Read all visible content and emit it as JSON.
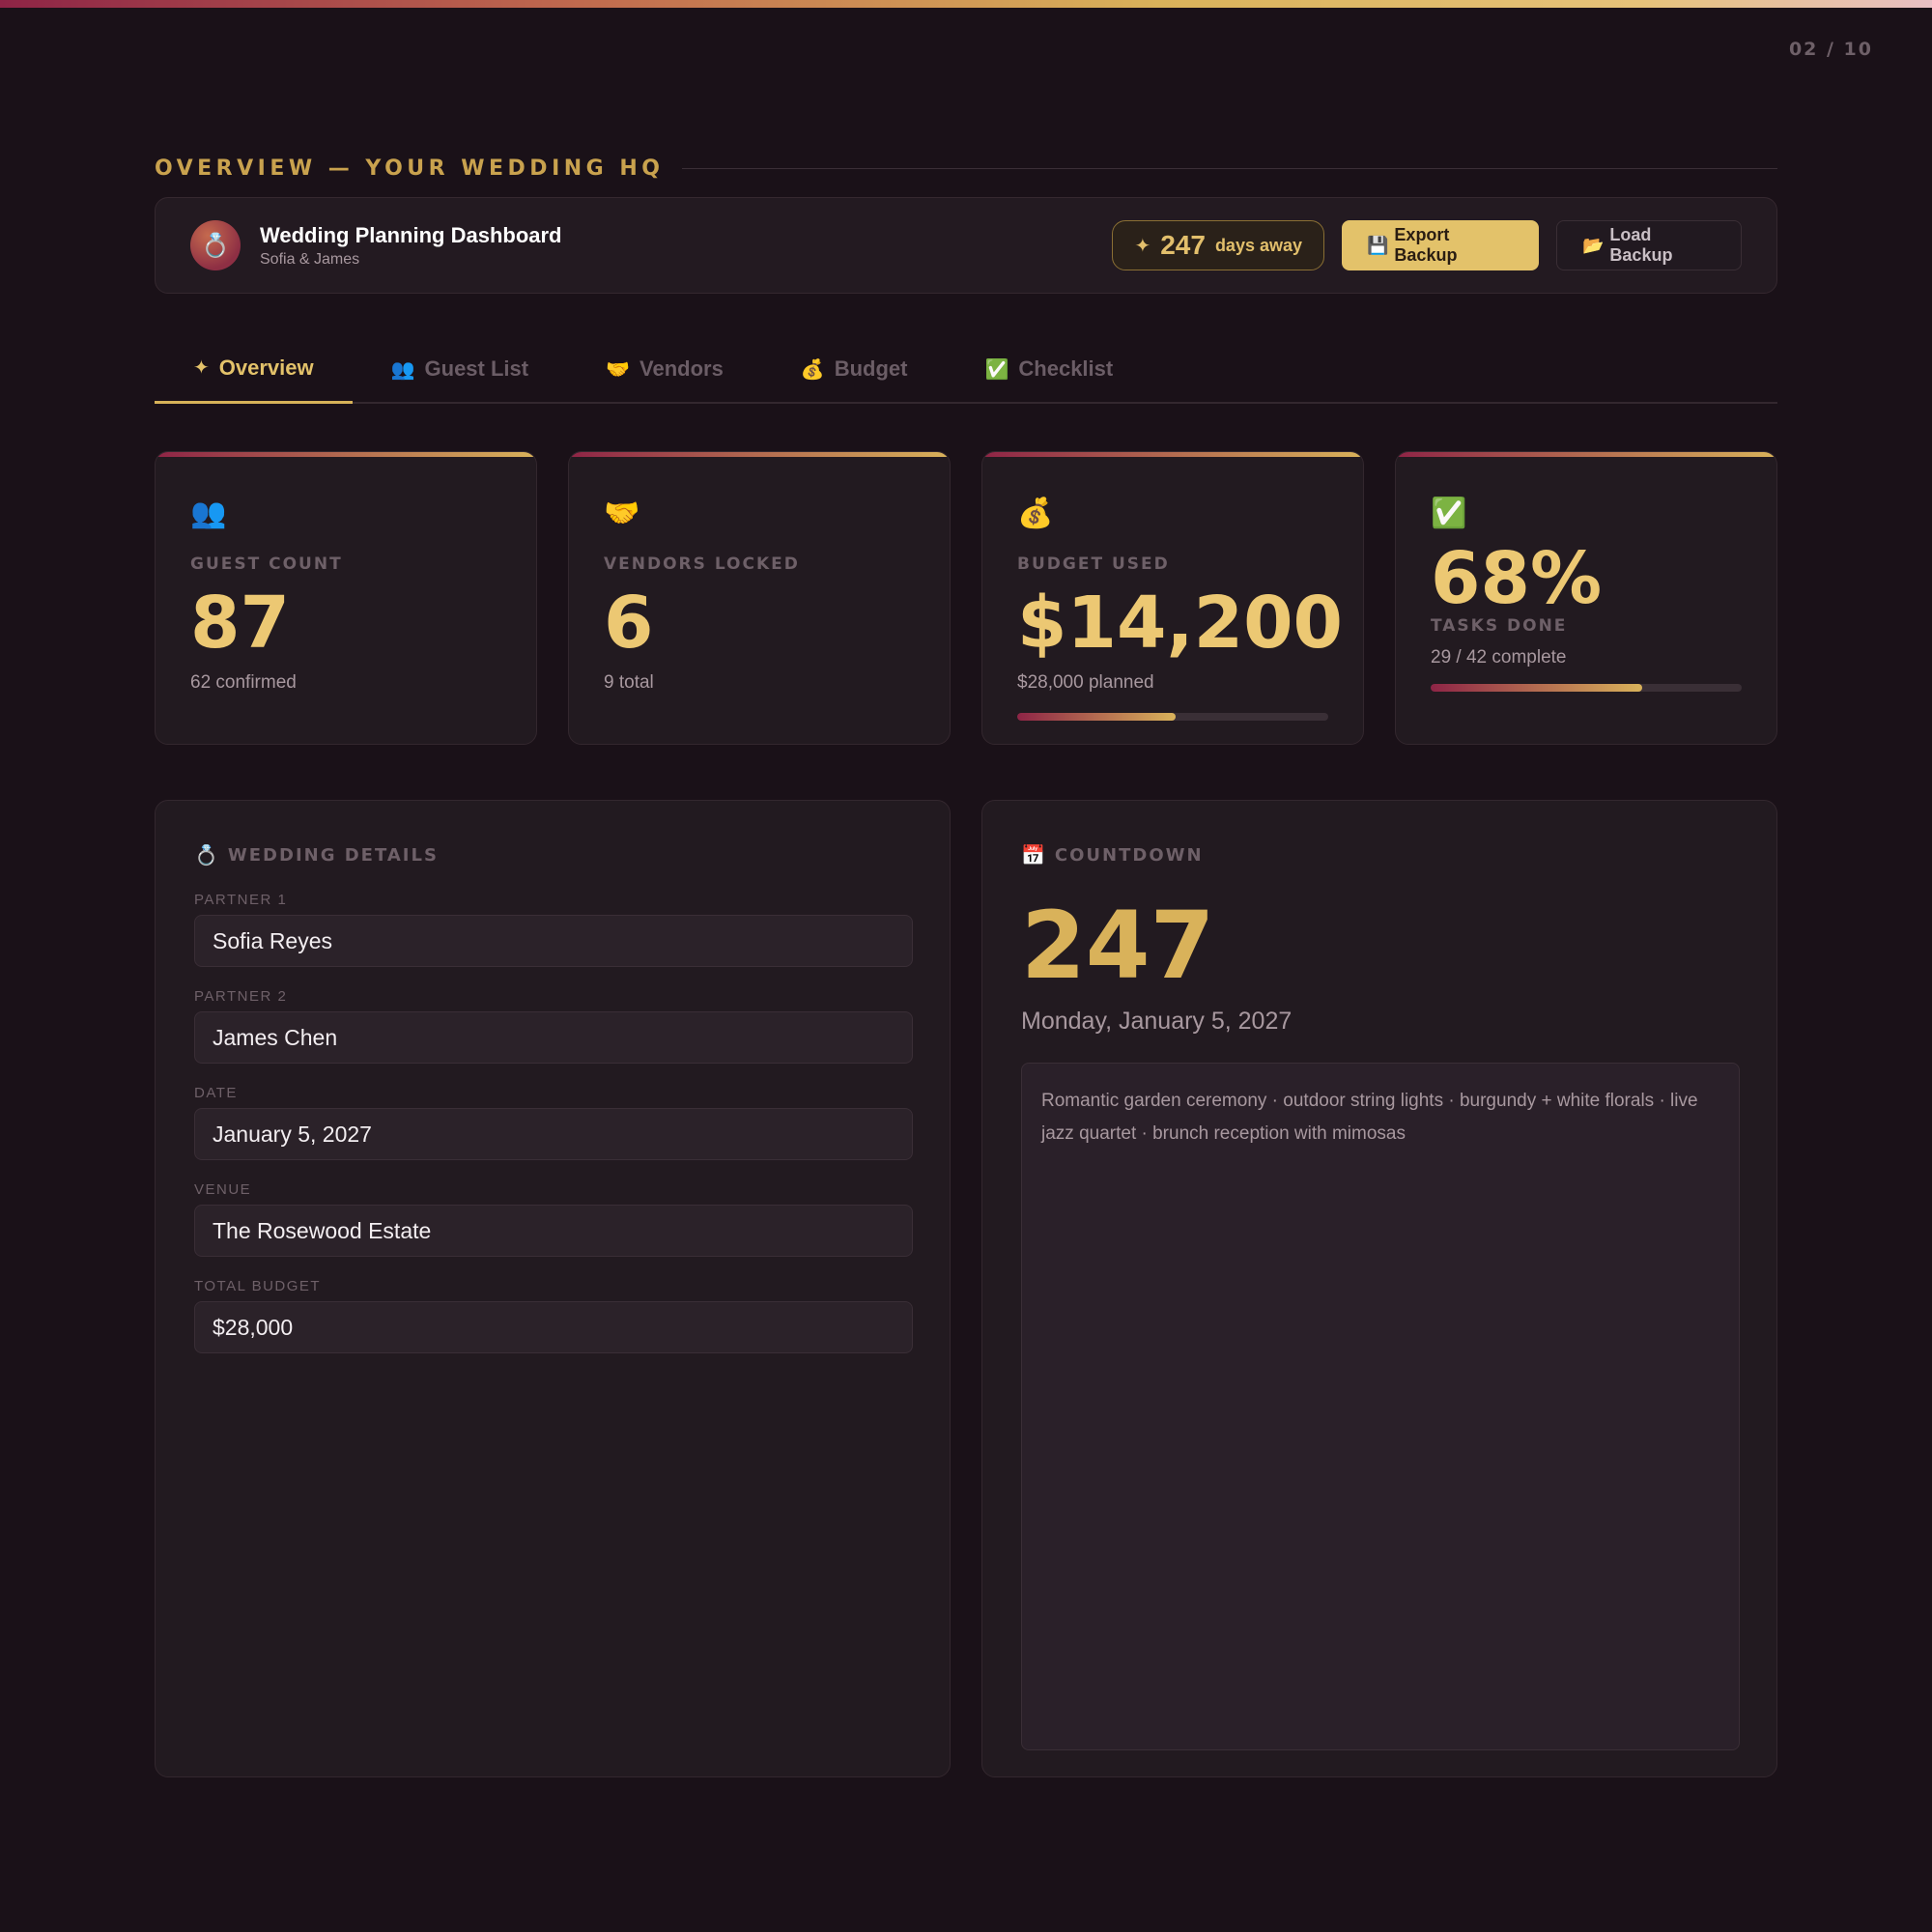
{
  "page_indicator": "02 / 10",
  "section_heading": "OVERVIEW — YOUR WEDDING HQ",
  "header": {
    "avatar_icon": "ring-icon",
    "avatar_glyph": "💍",
    "title": "Wedding Planning Dashboard",
    "subtitle": "Sofia & James",
    "days_star": "✦",
    "days_count": "247",
    "days_label": "days away",
    "export_icon": "💾",
    "export_label": "Export Backup",
    "load_icon": "📂",
    "load_label": "Load Backup"
  },
  "tabs": [
    {
      "icon": "✦",
      "label": "Overview",
      "active": true
    },
    {
      "icon": "👥",
      "label": "Guest List",
      "active": false
    },
    {
      "icon": "🤝",
      "label": "Vendors",
      "active": false
    },
    {
      "icon": "💰",
      "label": "Budget",
      "active": false
    },
    {
      "icon": "✅",
      "label": "Checklist",
      "active": false
    }
  ],
  "stats": {
    "guests": {
      "icon": "👥",
      "label": "GUEST COUNT",
      "value": "87",
      "sub": "62 confirmed"
    },
    "vendors": {
      "icon": "🤝",
      "label": "VENDORS LOCKED",
      "value": "6",
      "sub": "9 total"
    },
    "budget": {
      "icon": "💰",
      "label": "BUDGET USED",
      "value": "$14,200",
      "sub": "$28,000 planned",
      "progress_percent": 51
    },
    "tasks": {
      "icon": "✅",
      "label": "TASKS DONE",
      "value": "68%",
      "sub": "29 / 42 complete",
      "progress_percent": 68
    }
  },
  "details": {
    "icon": "💍",
    "title": "WEDDING DETAILS",
    "fields": [
      {
        "label": "PARTNER 1",
        "value": "Sofia Reyes"
      },
      {
        "label": "PARTNER 2",
        "value": "James Chen"
      },
      {
        "label": "DATE",
        "value": "January 5, 2027"
      },
      {
        "label": "VENUE",
        "value": "The Rosewood Estate"
      },
      {
        "label": "TOTAL BUDGET",
        "value": "$28,000"
      }
    ]
  },
  "countdown": {
    "icon": "📅",
    "title": "COUNTDOWN",
    "days": "247",
    "date": "Monday, January 5, 2027",
    "notes": "Romantic garden ceremony · outdoor string lights · burgundy + white florals · live jazz quartet · brunch reception with mimosas"
  },
  "colors": {
    "background": "#1a1118",
    "accent_gold": "#e3c26a",
    "accent_burgundy": "#8e2446",
    "card": "#221a20"
  }
}
